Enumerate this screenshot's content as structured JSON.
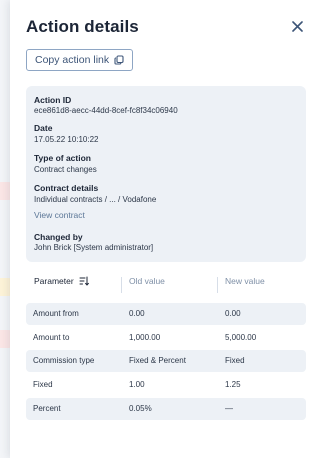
{
  "panel": {
    "title": "Action details",
    "copy_link_label": "Copy action link"
  },
  "details": [
    {
      "label": "Action ID",
      "value": "ece861d8-aecc-44dd-8cef-fc8f34c06940"
    },
    {
      "label": "Date",
      "value": "17.05.22 10:10:22"
    },
    {
      "label": "Type of action",
      "value": "Contract changes"
    },
    {
      "label": "Contract details",
      "value": "Individual contracts / ... / Vodafone"
    },
    {
      "label": "Changed by",
      "value": "John Brick [System administrator]"
    }
  ],
  "view_contract_label": "View contract",
  "table": {
    "headers": {
      "parameter": "Parameter",
      "old": "Old value",
      "new": "New value"
    },
    "rows": [
      {
        "parameter": "Amount from",
        "old": "0.00",
        "new": "0.00"
      },
      {
        "parameter": "Amount to",
        "old": "1,000.00",
        "new": "5,000.00"
      },
      {
        "parameter": "Commission type",
        "old": "Fixed & Percent",
        "new": "Fixed"
      },
      {
        "parameter": "Fixed",
        "old": "1.00",
        "new": "1.25"
      },
      {
        "parameter": "Percent",
        "old": "0.05%",
        "new": "—"
      }
    ]
  },
  "icons": {
    "close": "close-icon",
    "copy": "copy-icon",
    "sort": "sort-icon"
  },
  "colors": {
    "accent": "#3d5578",
    "panel_tint": "#edf1f6",
    "link": "#5c7797"
  }
}
